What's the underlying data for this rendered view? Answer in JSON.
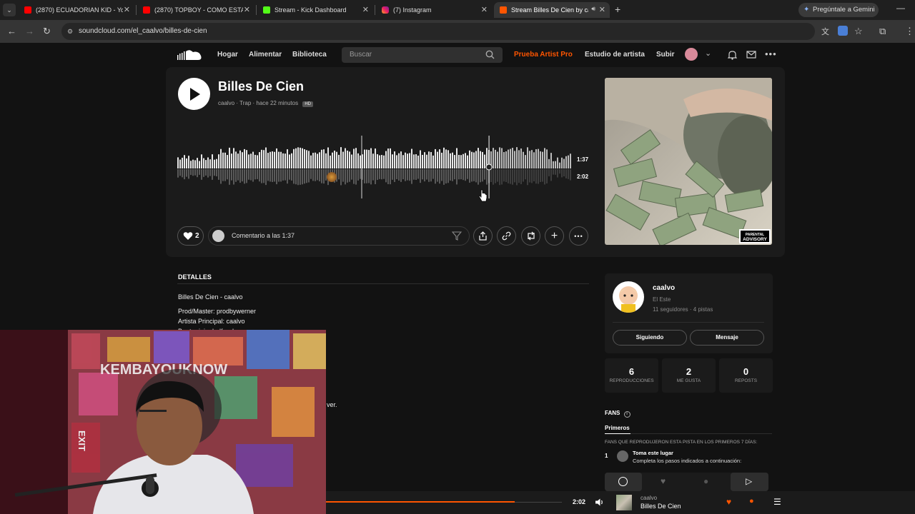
{
  "browser": {
    "tabs": [
      {
        "title": "(2870) ECUADORIAN KID - YouTube",
        "icon": "youtube-icon"
      },
      {
        "title": "(2870) TOPBOY - COMO ESTAS",
        "icon": "youtube-icon"
      },
      {
        "title": "Stream - Kick Dashboard",
        "icon": "kick-icon"
      },
      {
        "title": "(7) Instagram",
        "icon": "instagram-icon"
      },
      {
        "title": "Stream Billes De Cien by ca",
        "icon": "soundcloud-icon"
      }
    ],
    "gemini_label": "Pregúntale a Gemini",
    "url": "soundcloud.com/el_caalvo/billes-de-cien"
  },
  "header": {
    "nav": [
      "Hogar",
      "Alimentar",
      "Biblioteca"
    ],
    "search_placeholder": "Buscar",
    "pro_label": "Prueba Artist Pro",
    "studio_label": "Estudio de artista",
    "upload_label": "Subir"
  },
  "track": {
    "title": "Billes De Cien",
    "artist": "caalvo",
    "genre": "Trap",
    "posted": "hace 22 minutos",
    "hd_badge": "HD",
    "time_current": "1:37",
    "time_total": "2:02",
    "progress_fraction": 0.79,
    "likes": "2",
    "comment_placeholder": "Comentario a las 1:37",
    "explicit_label": "PARENTAL ADVISORY EXPLICIT CONTENT"
  },
  "details": {
    "heading": "DETALLES",
    "line1": "Billes De Cien - caalvo",
    "line2": "Prod/Master: prodbywerner",
    "line3": "Artista Principal: caalvo",
    "line4": "Beat original: dfs wheo",
    "fragment": "ver."
  },
  "artist_card": {
    "name": "caalvo",
    "location": "El Este",
    "stats": "11 seguidores · 4 pistas",
    "following_label": "Siguiendo",
    "message_label": "Mensaje"
  },
  "stats": [
    {
      "value": "6",
      "label": "REPRODUCCIONES"
    },
    {
      "value": "2",
      "label": "ME GUSTA"
    },
    {
      "value": "0",
      "label": "REPOSTS"
    }
  ],
  "fans": {
    "heading": "FANS",
    "tab": "Primeros",
    "caption": "FANS QUE REPRODUJERON ESTA PISTA EN LOS PRIMEROS 7 DÍAS:",
    "rank": "1",
    "entry_title": "Toma este lugar",
    "entry_sub": "Completa los pasos indicados a continuación:"
  },
  "webcam": {
    "sticker_text": "KEMBAYOUKNOW",
    "sign_text": "EXIT"
  },
  "player": {
    "time": "2:02",
    "artist": "caalvo",
    "title": "Billes De Cien"
  },
  "colors": {
    "accent": "#ff5500",
    "background": "#121212",
    "panel": "#1b1b1b"
  }
}
